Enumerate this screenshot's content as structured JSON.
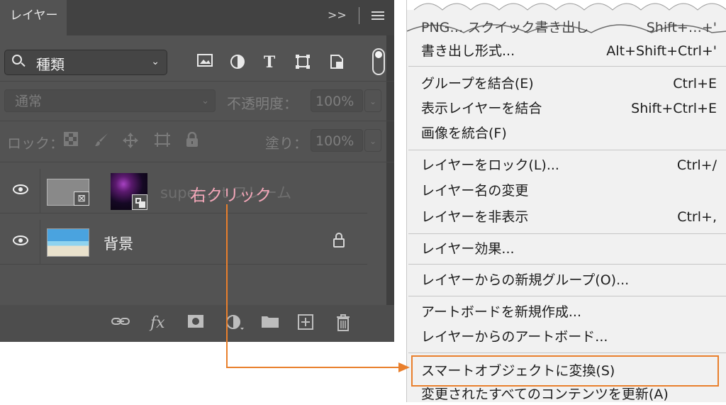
{
  "layers_panel": {
    "tab_label": "レイヤー",
    "collapse_glyph": ">>",
    "filter": {
      "label": "種類",
      "chevron": "⌄"
    },
    "filter_icons": [
      "image-filter-icon",
      "adjustment-filter-icon",
      "type-filter-icon",
      "shape-filter-icon",
      "smart-object-filter-icon"
    ],
    "blend_mode": "通常",
    "opacity_label": "不透明度：",
    "opacity_value": "100%",
    "lock_label": "ロック：",
    "fill_label": "塗り：",
    "fill_value": "100%",
    "layers": [
      {
        "name": "super… t フレーム",
        "type": "frame",
        "visible": true
      },
      {
        "name": "背景",
        "type": "background",
        "visible": true,
        "locked": true
      }
    ],
    "bottom_icons": [
      "link-icon",
      "fx-icon",
      "mask-icon",
      "adjustment-icon",
      "folder-icon",
      "new-layer-icon",
      "trash-icon"
    ],
    "fx_label": "fx"
  },
  "callout": {
    "text": "右クリック",
    "color": "#f4a7b9",
    "arrow_color": "#e97f2c"
  },
  "context_menu": {
    "torn_item": {
      "label": "PNG… スクイック書き出し",
      "shortcut": "Shift+…+'"
    },
    "items": [
      {
        "label": "書き出し形式...",
        "shortcut": "Alt+Shift+Ctrl+'"
      },
      {
        "label": "グループを結合(E)",
        "shortcut": "Ctrl+E"
      },
      {
        "label": "表示レイヤーを結合",
        "shortcut": "Shift+Ctrl+E"
      },
      {
        "label": "画像を統合(F)",
        "shortcut": ""
      },
      {
        "label": "レイヤーをロック(L)...",
        "shortcut": "Ctrl+/"
      },
      {
        "label": "レイヤー名の変更",
        "shortcut": ""
      },
      {
        "label": "レイヤーを非表示",
        "shortcut": "Ctrl+,"
      },
      {
        "label": "レイヤー効果...",
        "shortcut": ""
      },
      {
        "label": "レイヤーからの新規グループ(O)...",
        "shortcut": ""
      },
      {
        "label": "アートボードを新規作成...",
        "shortcut": ""
      },
      {
        "label": "レイヤーからのアートボード...",
        "shortcut": ""
      },
      {
        "label": "スマートオブジェクトに変換(S)",
        "shortcut": "",
        "highlighted": true
      },
      {
        "label": "変更されたすべてのコンテンツを更新(A)",
        "shortcut": ""
      }
    ]
  },
  "colors": {
    "panel_bg": "#535353",
    "tab_bar": "#424242",
    "menu_bg": "#f1f1f1",
    "highlight_border": "#e97f2c"
  }
}
